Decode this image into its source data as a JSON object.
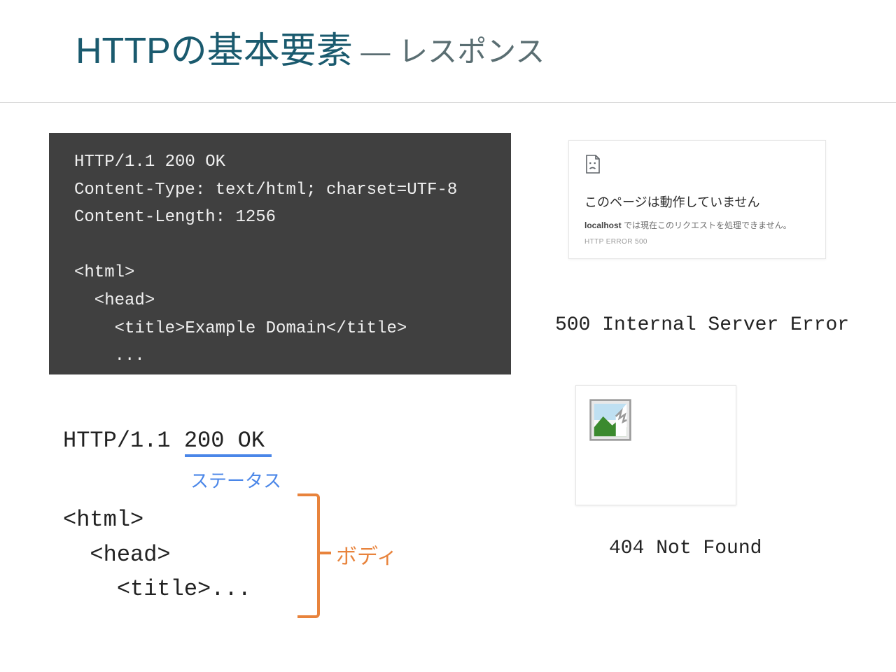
{
  "title": {
    "main": "HTTPの基本要素",
    "sep": " — ",
    "sub": "レスポンス"
  },
  "code": "HTTP/1.1 200 OK\nContent-Type: text/html; charset=UTF-8\nContent-Length: 1256\n\n<html>\n  <head>\n    <title>Example Domain</title>\n    ...",
  "anno": {
    "status_line": "HTTP/1.1 200 OK",
    "status_label": "ステータス",
    "body_code": "<html>\n  <head>\n    <title>...",
    "body_label": "ボディ"
  },
  "error500": {
    "title": "このページは動作していません",
    "msg_bold": "localhost",
    "msg_rest": " では現在このリクエストを処理できません。",
    "code": "HTTP ERROR 500",
    "label": "500 Internal Server Error"
  },
  "error404": {
    "label": "404 Not Found"
  }
}
